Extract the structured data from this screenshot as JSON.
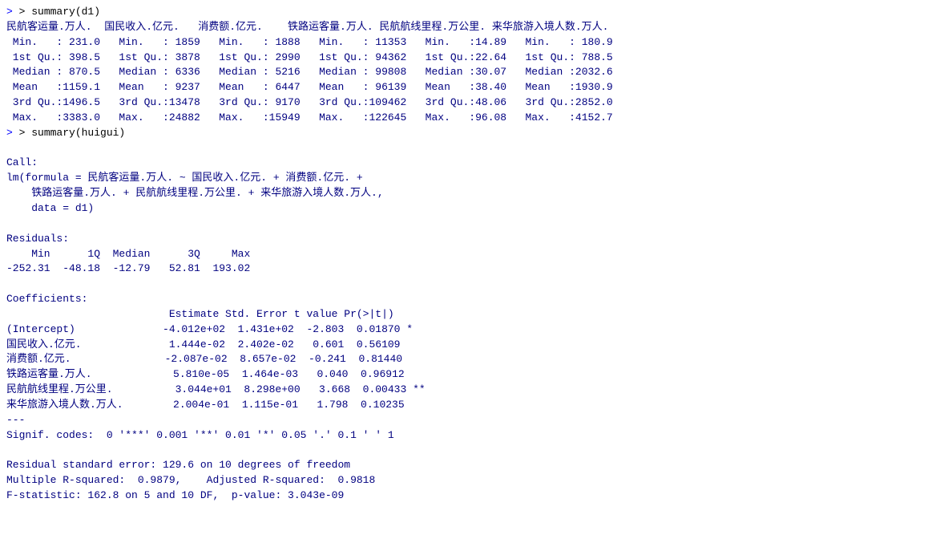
{
  "console": {
    "lines": [
      {
        "type": "prompt",
        "text": "> summary(d1)"
      },
      {
        "type": "header",
        "text": "民航客运量.万人.  国民收入.亿元.   消费额.亿元.    铁路运客量.万人. 民航航线里程.万公里. 来华旅游入境人数.万人."
      },
      {
        "type": "data",
        "text": " Min.   : 231.0   Min.   : 1859   Min.   : 1888   Min.   : 11353   Min.   :14.89   Min.   : 180.9 "
      },
      {
        "type": "data",
        "text": " 1st Qu.: 398.5   1st Qu.: 3878   1st Qu.: 2990   1st Qu.: 94362   1st Qu.:22.64   1st Qu.: 788.5 "
      },
      {
        "type": "data",
        "text": " Median : 870.5   Median : 6336   Median : 5216   Median : 99808   Median :30.07   Median :2032.6 "
      },
      {
        "type": "data",
        "text": " Mean   :1159.1   Mean   : 9237   Mean   : 6447   Mean   : 96139   Mean   :38.40   Mean   :1930.9 "
      },
      {
        "type": "data",
        "text": " 3rd Qu.:1496.5   3rd Qu.:13478   3rd Qu.: 9170   3rd Qu.:109462   3rd Qu.:48.06   3rd Qu.:2852.0 "
      },
      {
        "type": "data",
        "text": " Max.   :3383.0   Max.   :24882   Max.   :15949   Max.   :122645   Max.   :96.08   Max.   :4152.7 "
      },
      {
        "type": "prompt",
        "text": "> summary(huigui)"
      },
      {
        "type": "blank"
      },
      {
        "type": "data",
        "text": "Call:"
      },
      {
        "type": "data",
        "text": "lm(formula = 民航客运量.万人. ~ 国民收入.亿元. + 消费额.亿元. +"
      },
      {
        "type": "data",
        "text": "    铁路运客量.万人. + 民航航线里程.万公里. + 来华旅游入境人数.万人.,"
      },
      {
        "type": "data",
        "text": "    data = d1)"
      },
      {
        "type": "blank"
      },
      {
        "type": "data",
        "text": "Residuals:"
      },
      {
        "type": "data",
        "text": "    Min      1Q  Median      3Q     Max"
      },
      {
        "type": "data",
        "text": "-252.31  -48.18  -12.79   52.81  193.02"
      },
      {
        "type": "blank"
      },
      {
        "type": "data",
        "text": "Coefficients:"
      },
      {
        "type": "data",
        "text": "                          Estimate Std. Error t value Pr(>|t|)   "
      },
      {
        "type": "data",
        "text": "(Intercept)              -4.012e+02  1.431e+02  -2.803  0.01870 * "
      },
      {
        "type": "data",
        "text": "国民收入.亿元.              1.444e-02  2.402e-02   0.601  0.56109   "
      },
      {
        "type": "data",
        "text": "消费额.亿元.               -2.087e-02  8.657e-02  -0.241  0.81440   "
      },
      {
        "type": "data",
        "text": "铁路运客量.万人.             5.810e-05  1.464e-03   0.040  0.96912   "
      },
      {
        "type": "data",
        "text": "民航航线里程.万公里.          3.044e+01  8.298e+00   3.668  0.00433 **"
      },
      {
        "type": "data",
        "text": "来华旅游入境人数.万人.        2.004e-01  1.115e-01   1.798  0.10235   "
      },
      {
        "type": "data",
        "text": "---"
      },
      {
        "type": "data",
        "text": "Signif. codes:  0 '***' 0.001 '**' 0.01 '*' 0.05 '.' 0.1 ' ' 1"
      },
      {
        "type": "blank"
      },
      {
        "type": "data",
        "text": "Residual standard error: 129.6 on 10 degrees of freedom"
      },
      {
        "type": "data",
        "text": "Multiple R-squared:  0.9879,\tAdjusted R-squared:  0.9818"
      },
      {
        "type": "data",
        "text": "F-statistic: 162.8 on 5 and 10 DF,  p-value: 3.043e-09"
      }
    ]
  }
}
